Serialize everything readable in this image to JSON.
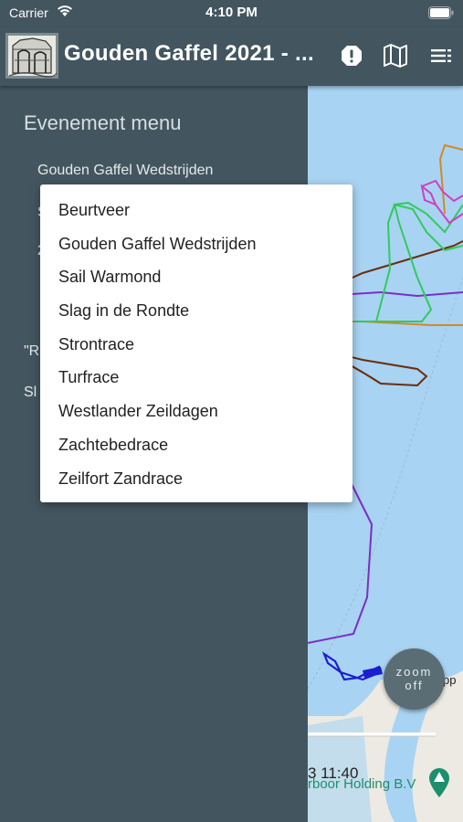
{
  "status_bar": {
    "carrier": "Carrier",
    "time": "4:10 PM"
  },
  "app_bar": {
    "title": "Gouden Gaffel 2021 - ...",
    "actions": [
      "alert-icon",
      "map-icon",
      "menu-list-icon"
    ]
  },
  "drawer": {
    "heading": "Evenement menu",
    "selected_event": "Gouden Gaffel Wedstrijden",
    "hidden_fragments": [
      "S",
      "2",
      "\"R",
      "Sl"
    ]
  },
  "dropdown": {
    "options": [
      "Beurtveer",
      "Gouden Gaffel Wedstrijden",
      "Sail Warmond",
      "Slag in de Rondte",
      "Strontrace",
      "Turfrace",
      "Westlander Zeildagen",
      "Zachtebedrace",
      "Zeilfort Zandrace"
    ]
  },
  "map": {
    "zoom_button": "zoom off",
    "time_label": "3 11:40",
    "poi_label": "rboor Holding B.V",
    "edge_label": "pp",
    "colors": {
      "water": "#a9d3f2",
      "land": "#eceae3",
      "poi": "#1d8f6e"
    }
  }
}
